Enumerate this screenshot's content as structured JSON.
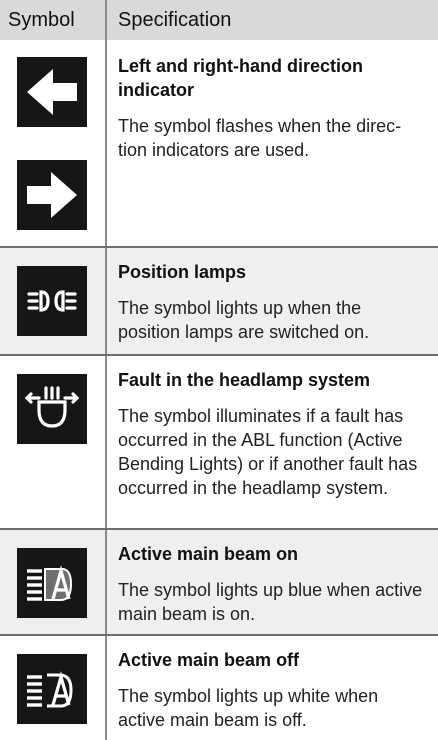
{
  "header": {
    "symbol_label": "Symbol",
    "specification_label": "Specification"
  },
  "rows": [
    {
      "icons": [
        "left-arrow-icon",
        "right-arrow-icon"
      ],
      "title": "Left and right-hand direction indicator",
      "description": "The symbol flashes when the direc-tion indicators are used."
    },
    {
      "icons": [
        "position-lamps-icon"
      ],
      "title": "Position lamps",
      "description": "The symbol lights up when the position lamps are switched on."
    },
    {
      "icons": [
        "headlamp-fault-icon"
      ],
      "title": "Fault in the headlamp system",
      "description": "The symbol illuminates if a fault has occurred in the ABL function (Active Bending Lights) or if another fault has occurred in the headlamp system."
    },
    {
      "icons": [
        "active-main-beam-on-icon"
      ],
      "title": "Active main beam on",
      "description": "The symbol lights up blue when active main beam is on."
    },
    {
      "icons": [
        "active-main-beam-off-icon"
      ],
      "title": "Active main beam off",
      "description": "The symbol lights up white when active main beam is off."
    }
  ],
  "colors": {
    "header_bg": "#d9d9d9",
    "alt_row_bg": "#efefef",
    "icon_bg": "#161616"
  }
}
